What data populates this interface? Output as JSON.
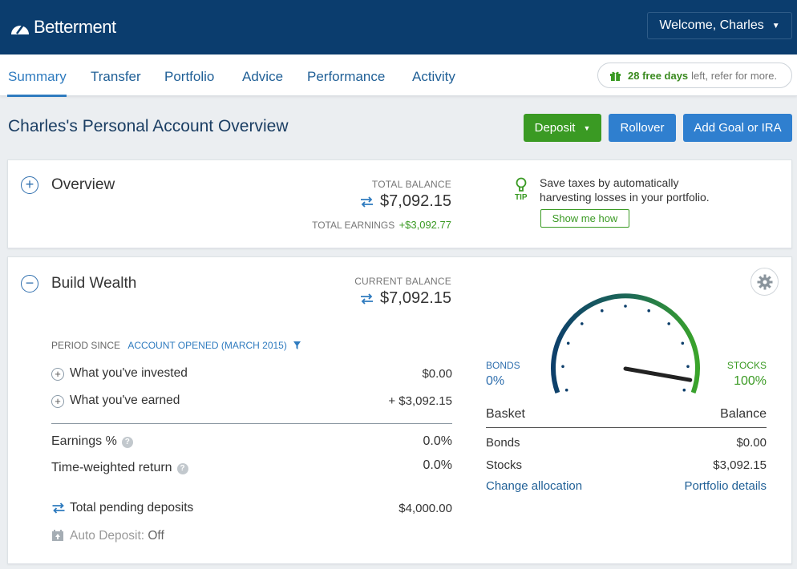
{
  "header": {
    "logo_text": "Betterment",
    "welcome_label": "Welcome, Charles",
    "welcome_caret": "▼"
  },
  "nav": {
    "tabs": [
      {
        "label": "Summary",
        "active": true
      },
      {
        "label": "Transfer"
      },
      {
        "label": "Portfolio"
      },
      {
        "label": "Advice"
      },
      {
        "label": "Performance"
      },
      {
        "label": "Activity"
      }
    ],
    "promo_bold": "28 free days",
    "promo_rest": "left, refer for more."
  },
  "page": {
    "title": "Charles's Personal Account Overview",
    "deposit_label": "Deposit",
    "deposit_caret": "▼",
    "rollover_label": "Rollover",
    "add_goal_label": "Add Goal or IRA"
  },
  "overview": {
    "toggle": "+",
    "title": "Overview",
    "total_balance_label": "TOTAL BALANCE",
    "total_balance": "$7,092.15",
    "total_earnings_label": "TOTAL EARNINGS",
    "total_earnings": "+$3,092.77",
    "tip_label": "TIP",
    "tip_text": "Save taxes by automatically harvesting losses in your portfolio.",
    "tip_button": "Show me how"
  },
  "build_wealth": {
    "toggle": "−",
    "title": "Build Wealth",
    "current_balance_label": "CURRENT BALANCE",
    "current_balance": "$7,092.15",
    "period_label": "PERIOD SINCE",
    "period_value": "ACCOUNT OPENED (MARCH 2015)",
    "invested_label": "What you've invested",
    "invested_value": "$0.00",
    "earned_label": "What you've earned",
    "earned_value": "+ $3,092.15",
    "earnings_pct_label": "Earnings %",
    "earnings_pct_value": "0.0%",
    "twr_label": "Time-weighted return",
    "twr_value": "0.0%",
    "pending_label": "Total pending deposits",
    "pending_value": "$4,000.00",
    "auto_deposit_label": "Auto Deposit:",
    "auto_deposit_value": "Off",
    "help_glyph": "?"
  },
  "allocation": {
    "bonds_label": "BONDS",
    "bonds_pct": "0%",
    "stocks_label": "STOCKS",
    "stocks_pct": "100%",
    "stocks_fraction": 1.0,
    "basket_header": "Basket",
    "balance_header": "Balance",
    "rows": [
      {
        "name": "Bonds",
        "value": "$0.00"
      },
      {
        "name": "Stocks",
        "value": "$3,092.15"
      }
    ],
    "change_link": "Change allocation",
    "details_link": "Portfolio details"
  },
  "colors": {
    "header_bg": "#0b3d6e",
    "accent_blue": "#2f7bbf",
    "accent_green": "#3a9a23"
  }
}
